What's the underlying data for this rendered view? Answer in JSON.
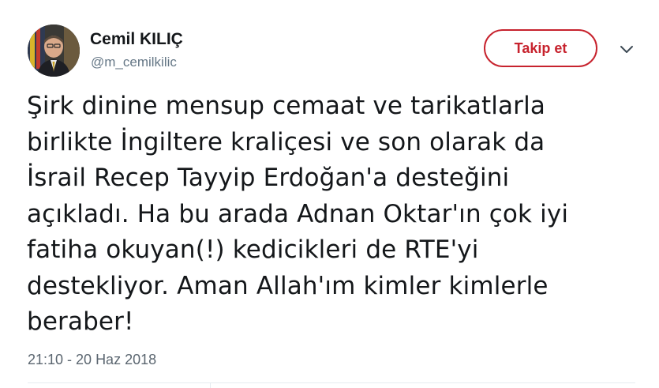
{
  "user": {
    "display_name": "Cemil KILIÇ",
    "handle": "@m_cemilkilic"
  },
  "actions": {
    "follow_label": "Takip et",
    "menu_icon": "chevron-down-icon"
  },
  "tweet": {
    "lines": [
      "Şirk dinine mensup cemaat ve tarikatlarla",
      "birlikte İngiltere kraliçesi ve son olarak da",
      "İsrail Recep Tayyip Erdoğan'a desteğini",
      "açıkladı. Ha bu arada Adnan Oktar'ın çok iyi",
      "fatiha okuyan(!) kedicikleri de RTE'yi",
      "destekliyor. Aman Allah'ım kimler kimlerle",
      "beraber!"
    ],
    "timestamp": "21:10 - 20 Haz 2018"
  },
  "colors": {
    "follow_accent": "#c7232e",
    "secondary_text": "#657786",
    "primary_text": "#14171a"
  }
}
